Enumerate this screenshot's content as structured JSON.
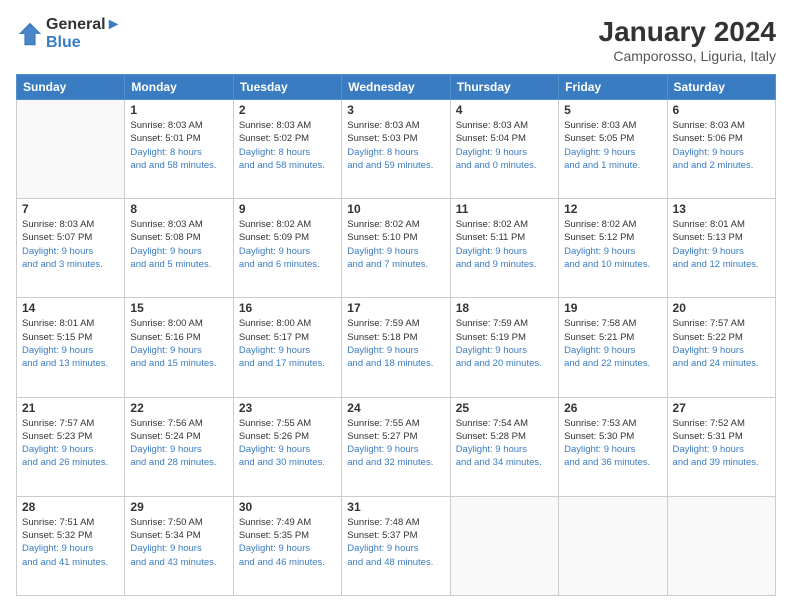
{
  "header": {
    "logo_line1": "General",
    "logo_line2": "Blue",
    "month": "January 2024",
    "location": "Camporosso, Liguria, Italy"
  },
  "weekdays": [
    "Sunday",
    "Monday",
    "Tuesday",
    "Wednesday",
    "Thursday",
    "Friday",
    "Saturday"
  ],
  "weeks": [
    [
      {
        "day": "",
        "sunrise": "",
        "sunset": "",
        "daylight": ""
      },
      {
        "day": "1",
        "sunrise": "Sunrise: 8:03 AM",
        "sunset": "Sunset: 5:01 PM",
        "daylight": "Daylight: 8 hours and 58 minutes."
      },
      {
        "day": "2",
        "sunrise": "Sunrise: 8:03 AM",
        "sunset": "Sunset: 5:02 PM",
        "daylight": "Daylight: 8 hours and 58 minutes."
      },
      {
        "day": "3",
        "sunrise": "Sunrise: 8:03 AM",
        "sunset": "Sunset: 5:03 PM",
        "daylight": "Daylight: 8 hours and 59 minutes."
      },
      {
        "day": "4",
        "sunrise": "Sunrise: 8:03 AM",
        "sunset": "Sunset: 5:04 PM",
        "daylight": "Daylight: 9 hours and 0 minutes."
      },
      {
        "day": "5",
        "sunrise": "Sunrise: 8:03 AM",
        "sunset": "Sunset: 5:05 PM",
        "daylight": "Daylight: 9 hours and 1 minute."
      },
      {
        "day": "6",
        "sunrise": "Sunrise: 8:03 AM",
        "sunset": "Sunset: 5:06 PM",
        "daylight": "Daylight: 9 hours and 2 minutes."
      }
    ],
    [
      {
        "day": "7",
        "sunrise": "Sunrise: 8:03 AM",
        "sunset": "Sunset: 5:07 PM",
        "daylight": "Daylight: 9 hours and 3 minutes."
      },
      {
        "day": "8",
        "sunrise": "Sunrise: 8:03 AM",
        "sunset": "Sunset: 5:08 PM",
        "daylight": "Daylight: 9 hours and 5 minutes."
      },
      {
        "day": "9",
        "sunrise": "Sunrise: 8:02 AM",
        "sunset": "Sunset: 5:09 PM",
        "daylight": "Daylight: 9 hours and 6 minutes."
      },
      {
        "day": "10",
        "sunrise": "Sunrise: 8:02 AM",
        "sunset": "Sunset: 5:10 PM",
        "daylight": "Daylight: 9 hours and 7 minutes."
      },
      {
        "day": "11",
        "sunrise": "Sunrise: 8:02 AM",
        "sunset": "Sunset: 5:11 PM",
        "daylight": "Daylight: 9 hours and 9 minutes."
      },
      {
        "day": "12",
        "sunrise": "Sunrise: 8:02 AM",
        "sunset": "Sunset: 5:12 PM",
        "daylight": "Daylight: 9 hours and 10 minutes."
      },
      {
        "day": "13",
        "sunrise": "Sunrise: 8:01 AM",
        "sunset": "Sunset: 5:13 PM",
        "daylight": "Daylight: 9 hours and 12 minutes."
      }
    ],
    [
      {
        "day": "14",
        "sunrise": "Sunrise: 8:01 AM",
        "sunset": "Sunset: 5:15 PM",
        "daylight": "Daylight: 9 hours and 13 minutes."
      },
      {
        "day": "15",
        "sunrise": "Sunrise: 8:00 AM",
        "sunset": "Sunset: 5:16 PM",
        "daylight": "Daylight: 9 hours and 15 minutes."
      },
      {
        "day": "16",
        "sunrise": "Sunrise: 8:00 AM",
        "sunset": "Sunset: 5:17 PM",
        "daylight": "Daylight: 9 hours and 17 minutes."
      },
      {
        "day": "17",
        "sunrise": "Sunrise: 7:59 AM",
        "sunset": "Sunset: 5:18 PM",
        "daylight": "Daylight: 9 hours and 18 minutes."
      },
      {
        "day": "18",
        "sunrise": "Sunrise: 7:59 AM",
        "sunset": "Sunset: 5:19 PM",
        "daylight": "Daylight: 9 hours and 20 minutes."
      },
      {
        "day": "19",
        "sunrise": "Sunrise: 7:58 AM",
        "sunset": "Sunset: 5:21 PM",
        "daylight": "Daylight: 9 hours and 22 minutes."
      },
      {
        "day": "20",
        "sunrise": "Sunrise: 7:57 AM",
        "sunset": "Sunset: 5:22 PM",
        "daylight": "Daylight: 9 hours and 24 minutes."
      }
    ],
    [
      {
        "day": "21",
        "sunrise": "Sunrise: 7:57 AM",
        "sunset": "Sunset: 5:23 PM",
        "daylight": "Daylight: 9 hours and 26 minutes."
      },
      {
        "day": "22",
        "sunrise": "Sunrise: 7:56 AM",
        "sunset": "Sunset: 5:24 PM",
        "daylight": "Daylight: 9 hours and 28 minutes."
      },
      {
        "day": "23",
        "sunrise": "Sunrise: 7:55 AM",
        "sunset": "Sunset: 5:26 PM",
        "daylight": "Daylight: 9 hours and 30 minutes."
      },
      {
        "day": "24",
        "sunrise": "Sunrise: 7:55 AM",
        "sunset": "Sunset: 5:27 PM",
        "daylight": "Daylight: 9 hours and 32 minutes."
      },
      {
        "day": "25",
        "sunrise": "Sunrise: 7:54 AM",
        "sunset": "Sunset: 5:28 PM",
        "daylight": "Daylight: 9 hours and 34 minutes."
      },
      {
        "day": "26",
        "sunrise": "Sunrise: 7:53 AM",
        "sunset": "Sunset: 5:30 PM",
        "daylight": "Daylight: 9 hours and 36 minutes."
      },
      {
        "day": "27",
        "sunrise": "Sunrise: 7:52 AM",
        "sunset": "Sunset: 5:31 PM",
        "daylight": "Daylight: 9 hours and 39 minutes."
      }
    ],
    [
      {
        "day": "28",
        "sunrise": "Sunrise: 7:51 AM",
        "sunset": "Sunset: 5:32 PM",
        "daylight": "Daylight: 9 hours and 41 minutes."
      },
      {
        "day": "29",
        "sunrise": "Sunrise: 7:50 AM",
        "sunset": "Sunset: 5:34 PM",
        "daylight": "Daylight: 9 hours and 43 minutes."
      },
      {
        "day": "30",
        "sunrise": "Sunrise: 7:49 AM",
        "sunset": "Sunset: 5:35 PM",
        "daylight": "Daylight: 9 hours and 46 minutes."
      },
      {
        "day": "31",
        "sunrise": "Sunrise: 7:48 AM",
        "sunset": "Sunset: 5:37 PM",
        "daylight": "Daylight: 9 hours and 48 minutes."
      },
      {
        "day": "",
        "sunrise": "",
        "sunset": "",
        "daylight": ""
      },
      {
        "day": "",
        "sunrise": "",
        "sunset": "",
        "daylight": ""
      },
      {
        "day": "",
        "sunrise": "",
        "sunset": "",
        "daylight": ""
      }
    ]
  ]
}
